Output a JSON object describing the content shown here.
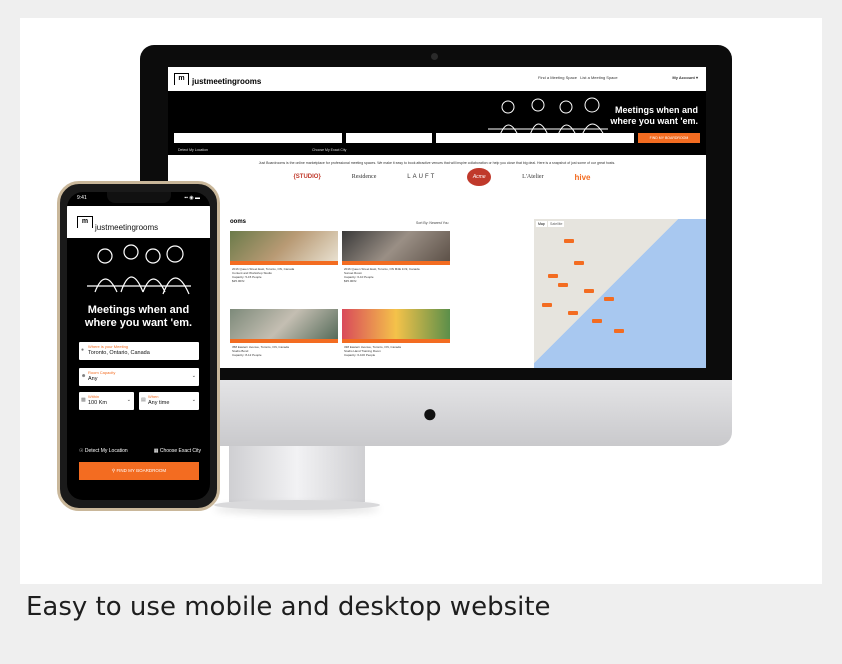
{
  "caption": "Easy to use mobile and desktop website",
  "desktop": {
    "logo_mark": "m",
    "logo_text": "justmeetingrooms",
    "nav_link_1": "Find a Meeting Space",
    "nav_link_2": "List a Meeting Space",
    "account": "My Account ▾",
    "headline_1": "Meetings when and",
    "headline_2": "where you want 'em.",
    "search_button": "FIND MY BOARDROOM",
    "sub_detect": "Detect My Location",
    "sub_city": "Choose My Exact City",
    "tagline": "Just Boardrooms is the online marketplace for professional meeting spaces. We make it easy to book attractive venues that will inspire collaboration or help you close that big deal. Here is a snapshot of just some of our great hosts.",
    "brands": [
      "{STUDIO}",
      "Residence",
      "LAUFT",
      "Acme",
      "L'Atelier",
      "hive"
    ],
    "results_title": "ooms",
    "sort_label": "Sort By: Nearest You",
    "rooms": [
      {
        "address": "2016 Queen Street East, Toronto, ON, Canada",
        "name": "Content and Workshop Studio",
        "capacity": "Capacity: 5-15 People",
        "rate": "$25.00/hr",
        "badge": "INSTANT BOOKING"
      },
      {
        "address": "2016 Queen Street East, Toronto, ON M4E 1C9, Canada",
        "name": "Sunset Room",
        "capacity": "Capacity: 6-10 People",
        "rate": "$35.00/hr",
        "badge": "INSTANT BOOKING"
      },
      {
        "address": "358 Eastern Avenue, Toronto, ON, Canada",
        "name": "Studio Bond",
        "capacity": "Capacity: 8-12 People",
        "rate": "",
        "badge": "INSTANT BOOKING"
      },
      {
        "address": "338 Eastern Avenue, Toronto, ON, Canada",
        "name": "Studio Hand Training Room",
        "capacity": "Capacity: 6-100 People",
        "rate": "",
        "badge": "INSTANT BOOKING"
      }
    ],
    "map_tab_1": "Map",
    "map_tab_2": "Satellite"
  },
  "phone": {
    "time": "9:41",
    "status_icons": "▪▪ ◉ ▬",
    "logo_mark": "m",
    "logo_text": "justmeetingrooms",
    "headline_1": "Meetings when and",
    "headline_2": "where you want 'em.",
    "where_label": "Where is your Meeting",
    "where_value": "Toronto, Ontario, Canada",
    "capacity_label": "Room Capacity",
    "capacity_value": "Any",
    "within_label": "Within",
    "within_value": "100 Km",
    "when_label": "When",
    "when_value": "Any time",
    "detect_link": "Detect My Location",
    "city_link": "Choose Exact City",
    "button": "FIND MY BOARDROOM"
  },
  "colors": {
    "accent": "#f36c21",
    "hero": "#000000"
  }
}
